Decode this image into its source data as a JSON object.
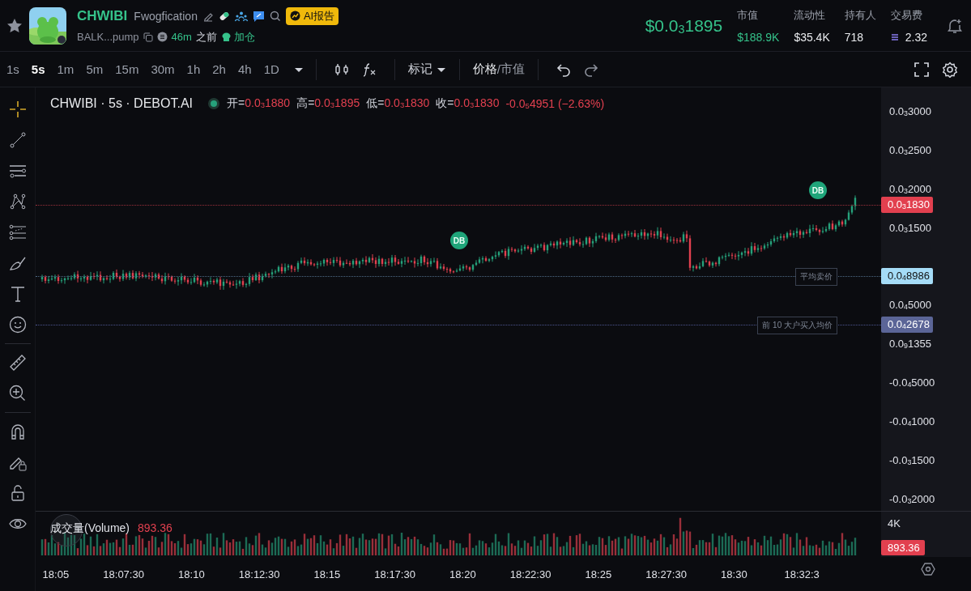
{
  "header": {
    "favorite": false,
    "symbol": "CHWIBI",
    "name": "Fwogfication",
    "ai_report": "AI报告",
    "address": "BALK...pump",
    "age": "46m",
    "age_suffix": "之前",
    "add_position": "加仓",
    "price": "$0.0$_{3}$1895",
    "stats": [
      {
        "label": "市值",
        "value": "$188.9K",
        "kind": "positive"
      },
      {
        "label": "流动性",
        "value": "$35.4K",
        "kind": "plain"
      },
      {
        "label": "持有人",
        "value": "718",
        "kind": "plain"
      },
      {
        "label": "交易费",
        "value": "2.32",
        "kind": "fee"
      }
    ]
  },
  "toolbar": {
    "intervals": [
      {
        "label": "1s",
        "selected": false
      },
      {
        "label": "5s",
        "selected": true
      },
      {
        "label": "1m",
        "selected": false
      },
      {
        "label": "5m",
        "selected": false
      },
      {
        "label": "15m",
        "selected": false
      },
      {
        "label": "30m",
        "selected": false
      },
      {
        "label": "1h",
        "selected": false
      },
      {
        "label": "2h",
        "selected": false
      },
      {
        "label": "4h",
        "selected": false
      },
      {
        "label": "1D",
        "selected": false
      }
    ],
    "marks_menu": "标记",
    "value_modes": [
      {
        "label": "价格",
        "selected": true
      },
      {
        "label": "市值",
        "selected": false
      }
    ],
    "value_mode_separator": "/"
  },
  "drawing_tools": [
    {
      "kind": "crosshair",
      "selected": true
    },
    {
      "kind": "trendline",
      "selected": false
    },
    {
      "kind": "channel",
      "selected": false
    },
    {
      "kind": "pattern",
      "selected": false
    },
    {
      "kind": "fib",
      "selected": false
    },
    {
      "kind": "brush",
      "selected": false
    },
    {
      "kind": "text",
      "selected": false
    },
    {
      "kind": "emoji",
      "selected": false
    },
    {
      "kind": "divider"
    },
    {
      "kind": "ruler",
      "selected": false
    },
    {
      "kind": "zoom",
      "selected": false
    },
    {
      "kind": "divider"
    },
    {
      "kind": "magnet",
      "selected": false
    },
    {
      "kind": "lock-drawing",
      "selected": false
    },
    {
      "kind": "lock",
      "selected": false
    },
    {
      "kind": "eye",
      "selected": false
    }
  ],
  "chart": {
    "legend": {
      "title": "CHWIBI · 5s · DEBOT.AI",
      "ohlc": [
        {
          "label": "开=",
          "value": "0.0$_{3}$1880"
        },
        {
          "label": "高=",
          "value": "0.0$_{3}$1895"
        },
        {
          "label": "低=",
          "value": "0.0$_{3}$1830"
        },
        {
          "label": "收=",
          "value": "0.0$_{3}$1830"
        }
      ],
      "change": "-0.0$_{5}$4951 (−2.63%)"
    },
    "price_axis": [
      "0.0$_{3}$3000",
      "0.0$_{3}$2500",
      "0.0$_{3}$2000",
      "0.0$_{3}$1500",
      "0.0$_{4}$5000",
      "0.0$_{9}$1355",
      "-0.0$_{4}$5000",
      "-0.0$_{4}$1000",
      "-0.0$_{3}$1500",
      "-0.0$_{3}$2000"
    ],
    "price_lines": [
      {
        "kind": "last",
        "value": "0.0$_{3}$1830"
      },
      {
        "kind": "avg_sell",
        "label": "平均卖价",
        "value": "0.0$_{4}$8986"
      },
      {
        "kind": "top10",
        "label": "前 10 大户买入均价",
        "value": "0.0$_{4}$2678"
      }
    ],
    "markers": [
      {
        "label": "DB"
      },
      {
        "label": "DB"
      }
    ],
    "volume": {
      "title": "成交量(Volume)",
      "value": "893.36",
      "axis_label": "4K",
      "last": "893.36"
    },
    "time_axis": [
      "18:05",
      "18:07:30",
      "18:10",
      "18:12:30",
      "18:15",
      "18:17:30",
      "18:20",
      "18:22:30",
      "18:25",
      "18:27:30",
      "18:30",
      "18:32:3"
    ]
  }
}
